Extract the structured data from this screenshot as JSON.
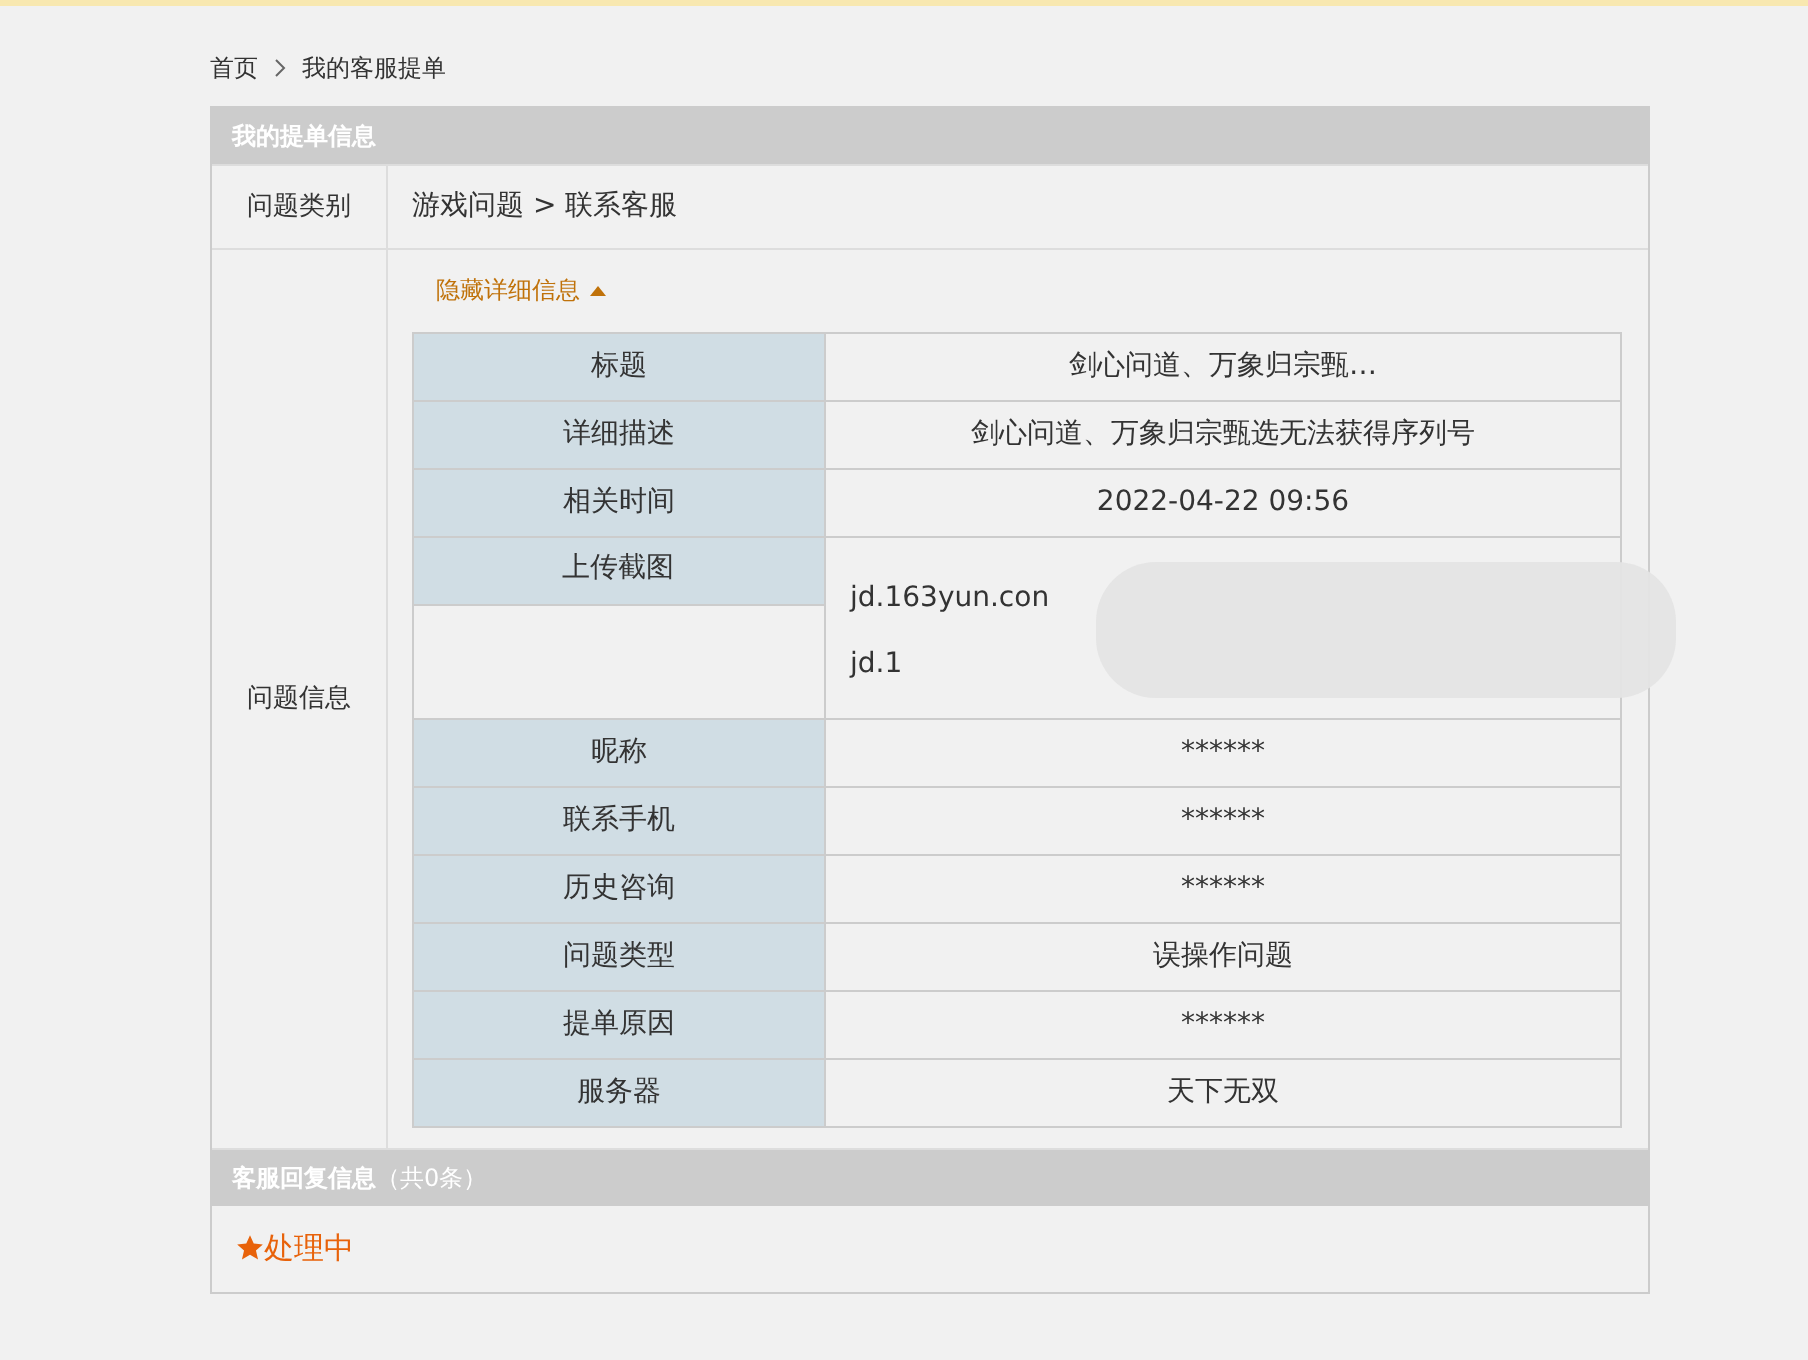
{
  "breadcrumb": [
    {
      "label": "首页"
    },
    {
      "label": "我的客服提单"
    }
  ],
  "ticket_section": {
    "title": "我的提单信息",
    "category": {
      "label": "问题类别",
      "value": "游戏问题 > 联系客服"
    },
    "details": {
      "label": "问题信息",
      "toggle": "隐藏详细信息",
      "expanded": true,
      "fields": [
        {
          "label": "标题",
          "value": "剑心问道、万象归宗甄…",
          "kind": "text"
        },
        {
          "label": "详细描述",
          "value": "剑心问道、万象归宗甄选无法获得序列号",
          "kind": "text"
        },
        {
          "label": "相关时间",
          "value": "2022-04-22 09:56",
          "kind": "text"
        },
        {
          "label": "上传截图",
          "lines": [
            "jd.163yun.con",
            "jd.1"
          ],
          "kind": "redacted"
        },
        {
          "label": "昵称",
          "value": "******",
          "kind": "text"
        },
        {
          "label": "联系手机",
          "value": "******",
          "kind": "text"
        },
        {
          "label": "历史咨询",
          "value": "******",
          "kind": "text"
        },
        {
          "label": "问题类型",
          "value": "误操作问题",
          "kind": "text"
        },
        {
          "label": "提单原因",
          "value": "******",
          "kind": "text"
        },
        {
          "label": "服务器",
          "value": "天下无双",
          "kind": "text"
        }
      ]
    }
  },
  "reply_section": {
    "title": "客服回复信息",
    "count": "（共0条）",
    "status": "处理中"
  }
}
